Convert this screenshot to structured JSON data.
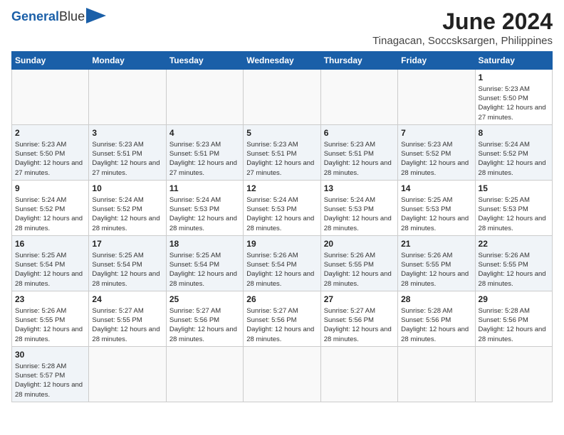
{
  "logo": {
    "text_general": "General",
    "text_blue": "Blue"
  },
  "title": "June 2024",
  "subtitle": "Tinagacan, Soccsksargen, Philippines",
  "headers": [
    "Sunday",
    "Monday",
    "Tuesday",
    "Wednesday",
    "Thursday",
    "Friday",
    "Saturday"
  ],
  "weeks": [
    [
      {
        "day": "",
        "empty": true
      },
      {
        "day": "",
        "empty": true
      },
      {
        "day": "",
        "empty": true
      },
      {
        "day": "",
        "empty": true
      },
      {
        "day": "",
        "empty": true
      },
      {
        "day": "",
        "empty": true
      },
      {
        "day": "1",
        "sunrise": "5:23 AM",
        "sunset": "5:50 PM",
        "daylight": "12 hours and 27 minutes."
      }
    ],
    [
      {
        "day": "2",
        "sunrise": "5:23 AM",
        "sunset": "5:50 PM",
        "daylight": "12 hours and 27 minutes."
      },
      {
        "day": "3",
        "sunrise": "5:23 AM",
        "sunset": "5:51 PM",
        "daylight": "12 hours and 27 minutes."
      },
      {
        "day": "4",
        "sunrise": "5:23 AM",
        "sunset": "5:51 PM",
        "daylight": "12 hours and 27 minutes."
      },
      {
        "day": "5",
        "sunrise": "5:23 AM",
        "sunset": "5:51 PM",
        "daylight": "12 hours and 27 minutes."
      },
      {
        "day": "6",
        "sunrise": "5:23 AM",
        "sunset": "5:51 PM",
        "daylight": "12 hours and 28 minutes."
      },
      {
        "day": "7",
        "sunrise": "5:23 AM",
        "sunset": "5:52 PM",
        "daylight": "12 hours and 28 minutes."
      },
      {
        "day": "8",
        "sunrise": "5:24 AM",
        "sunset": "5:52 PM",
        "daylight": "12 hours and 28 minutes."
      }
    ],
    [
      {
        "day": "9",
        "sunrise": "5:24 AM",
        "sunset": "5:52 PM",
        "daylight": "12 hours and 28 minutes."
      },
      {
        "day": "10",
        "sunrise": "5:24 AM",
        "sunset": "5:52 PM",
        "daylight": "12 hours and 28 minutes."
      },
      {
        "day": "11",
        "sunrise": "5:24 AM",
        "sunset": "5:53 PM",
        "daylight": "12 hours and 28 minutes."
      },
      {
        "day": "12",
        "sunrise": "5:24 AM",
        "sunset": "5:53 PM",
        "daylight": "12 hours and 28 minutes."
      },
      {
        "day": "13",
        "sunrise": "5:24 AM",
        "sunset": "5:53 PM",
        "daylight": "12 hours and 28 minutes."
      },
      {
        "day": "14",
        "sunrise": "5:25 AM",
        "sunset": "5:53 PM",
        "daylight": "12 hours and 28 minutes."
      },
      {
        "day": "15",
        "sunrise": "5:25 AM",
        "sunset": "5:53 PM",
        "daylight": "12 hours and 28 minutes."
      }
    ],
    [
      {
        "day": "16",
        "sunrise": "5:25 AM",
        "sunset": "5:54 PM",
        "daylight": "12 hours and 28 minutes."
      },
      {
        "day": "17",
        "sunrise": "5:25 AM",
        "sunset": "5:54 PM",
        "daylight": "12 hours and 28 minutes."
      },
      {
        "day": "18",
        "sunrise": "5:25 AM",
        "sunset": "5:54 PM",
        "daylight": "12 hours and 28 minutes."
      },
      {
        "day": "19",
        "sunrise": "5:26 AM",
        "sunset": "5:54 PM",
        "daylight": "12 hours and 28 minutes."
      },
      {
        "day": "20",
        "sunrise": "5:26 AM",
        "sunset": "5:55 PM",
        "daylight": "12 hours and 28 minutes."
      },
      {
        "day": "21",
        "sunrise": "5:26 AM",
        "sunset": "5:55 PM",
        "daylight": "12 hours and 28 minutes."
      },
      {
        "day": "22",
        "sunrise": "5:26 AM",
        "sunset": "5:55 PM",
        "daylight": "12 hours and 28 minutes."
      }
    ],
    [
      {
        "day": "23",
        "sunrise": "5:26 AM",
        "sunset": "5:55 PM",
        "daylight": "12 hours and 28 minutes."
      },
      {
        "day": "24",
        "sunrise": "5:27 AM",
        "sunset": "5:55 PM",
        "daylight": "12 hours and 28 minutes."
      },
      {
        "day": "25",
        "sunrise": "5:27 AM",
        "sunset": "5:56 PM",
        "daylight": "12 hours and 28 minutes."
      },
      {
        "day": "26",
        "sunrise": "5:27 AM",
        "sunset": "5:56 PM",
        "daylight": "12 hours and 28 minutes."
      },
      {
        "day": "27",
        "sunrise": "5:27 AM",
        "sunset": "5:56 PM",
        "daylight": "12 hours and 28 minutes."
      },
      {
        "day": "28",
        "sunrise": "5:28 AM",
        "sunset": "5:56 PM",
        "daylight": "12 hours and 28 minutes."
      },
      {
        "day": "29",
        "sunrise": "5:28 AM",
        "sunset": "5:56 PM",
        "daylight": "12 hours and 28 minutes."
      }
    ],
    [
      {
        "day": "30",
        "sunrise": "5:28 AM",
        "sunset": "5:57 PM",
        "daylight": "12 hours and 28 minutes."
      },
      {
        "day": "",
        "empty": true
      },
      {
        "day": "",
        "empty": true
      },
      {
        "day": "",
        "empty": true
      },
      {
        "day": "",
        "empty": true
      },
      {
        "day": "",
        "empty": true
      },
      {
        "day": "",
        "empty": true
      }
    ]
  ]
}
